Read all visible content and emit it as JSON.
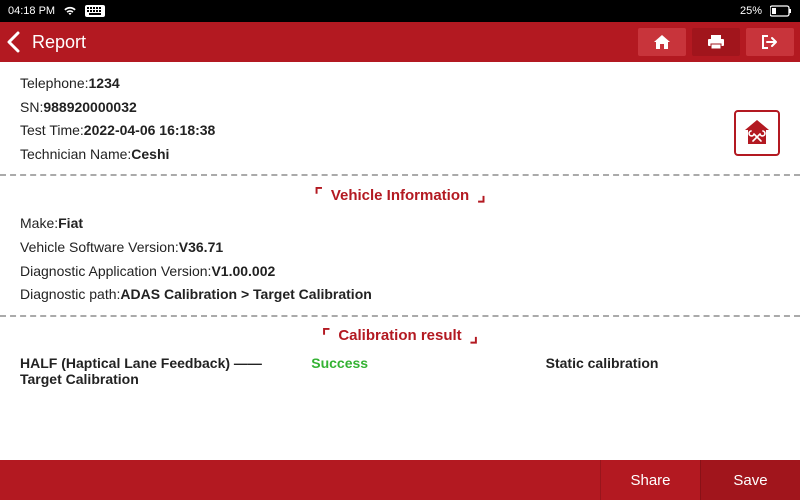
{
  "statusbar": {
    "time": "04:18 PM",
    "battery": "25%"
  },
  "titlebar": {
    "title": "Report"
  },
  "report": {
    "telephone_label": "Telephone:",
    "telephone": "1234",
    "sn_label": "SN:",
    "sn": "988920000032",
    "testtime_label": "Test Time:",
    "testtime": "2022-04-06 16:18:38",
    "tech_label": "Technician Name:",
    "tech": "Ceshi"
  },
  "vehicle": {
    "heading": "Vehicle Information",
    "make_label": "Make:",
    "make": "Fiat",
    "swver_label": "Vehicle Software Version:",
    "swver": "V36.71",
    "appver_label": "Diagnostic Application Version:",
    "appver": "V1.00.002",
    "path_label": "Diagnostic path:",
    "path": "ADAS Calibration > Target Calibration"
  },
  "calibration": {
    "heading": "Calibration result",
    "name": "HALF (Haptical Lane Feedback) —— Target Calibration",
    "status": "Success",
    "type": "Static calibration"
  },
  "bottom": {
    "share": "Share",
    "save": "Save"
  }
}
